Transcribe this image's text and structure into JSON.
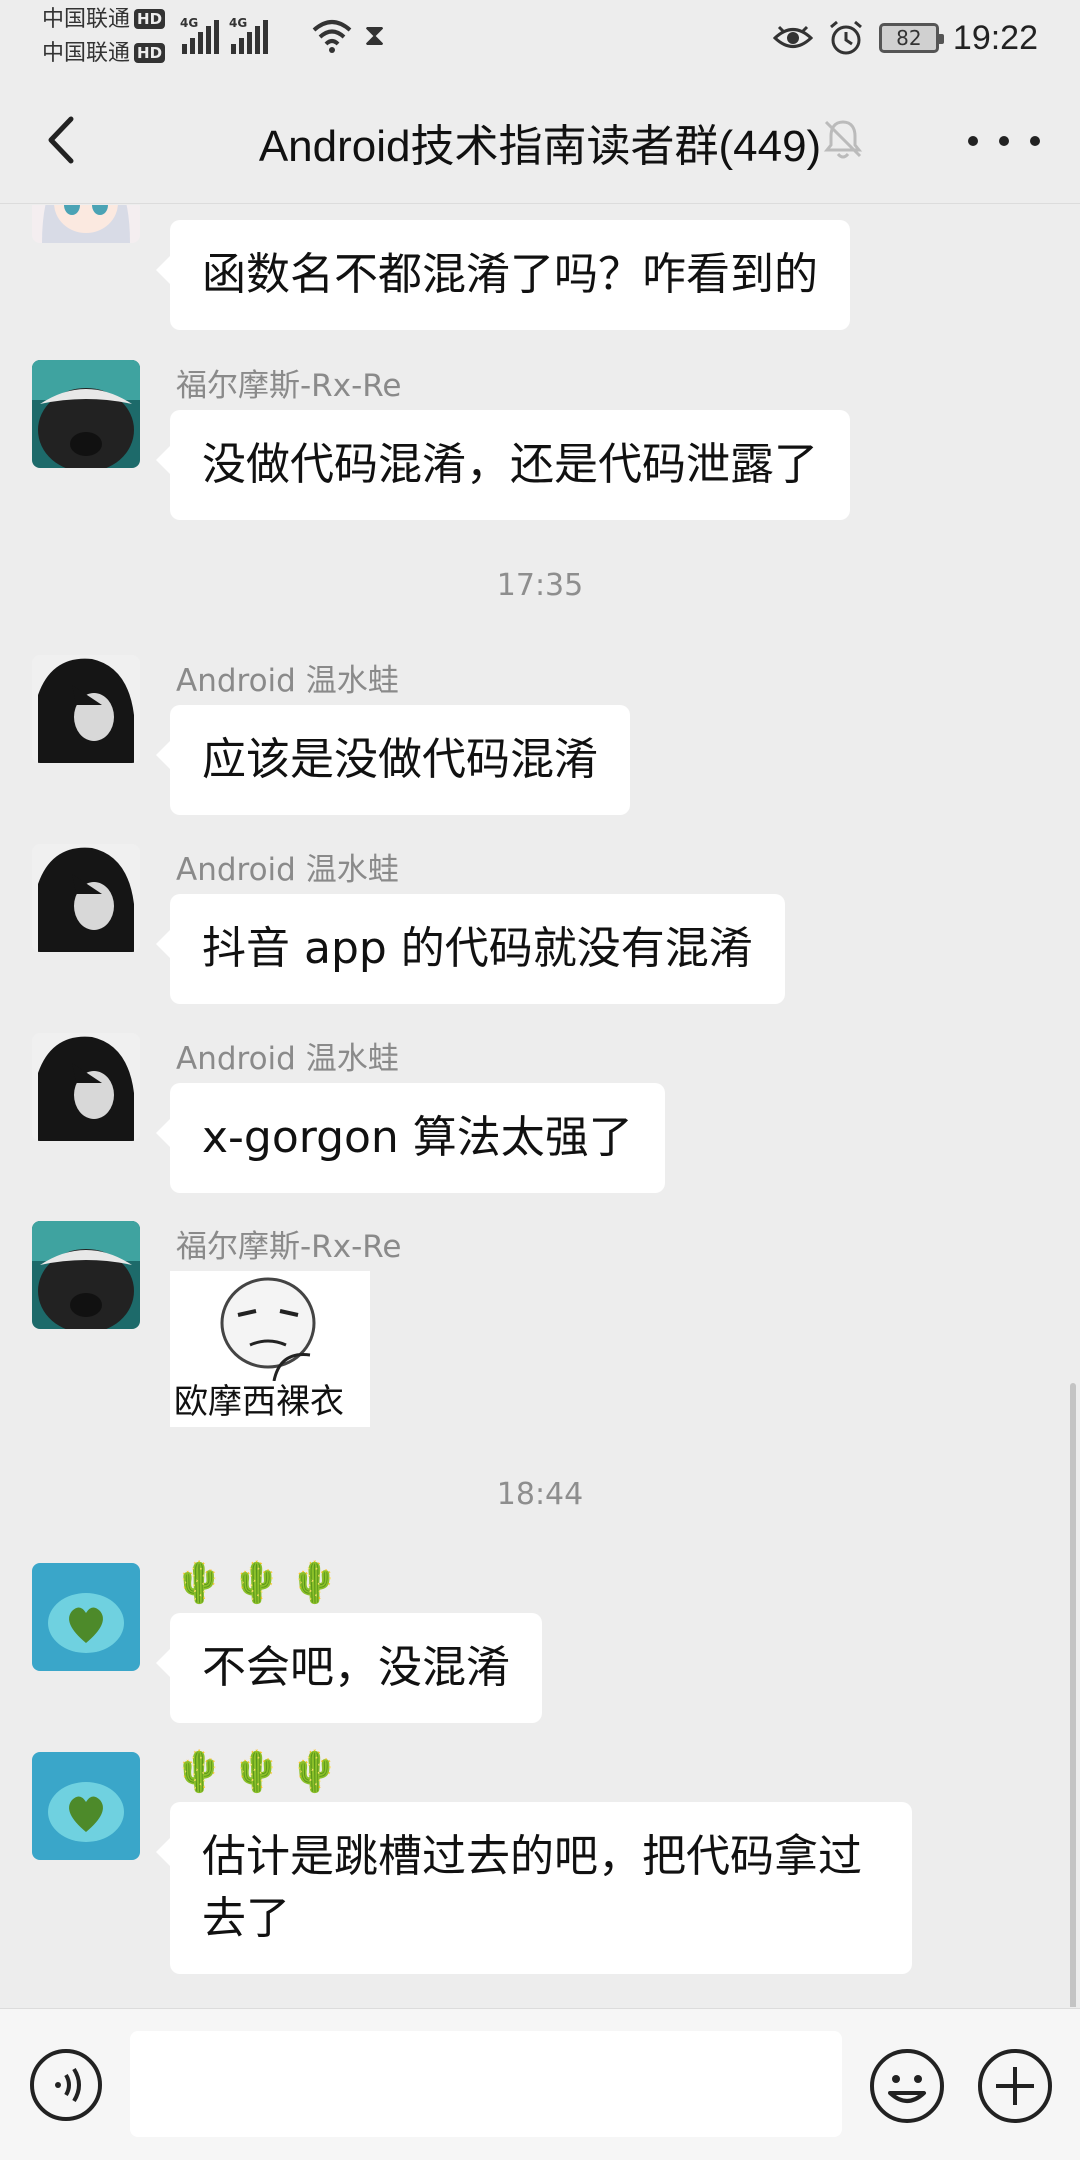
{
  "status_bar": {
    "carrier1": "中国联通",
    "carrier2": "中国联通",
    "hd": "HD",
    "network1": "4G",
    "network2": "4G",
    "battery": "82",
    "time": "19:22"
  },
  "nav": {
    "title": "Android技术指南读者群(449)"
  },
  "messages": [
    {
      "sender": "",
      "text": "函数名不都混淆了吗？咋看到的"
    },
    {
      "sender": "福尔摩斯-Rx-Re",
      "text": "没做代码混淆，还是代码泄露了"
    },
    {
      "sender": "Android 温水蛙",
      "text": "应该是没做代码混淆"
    },
    {
      "sender": "Android 温水蛙",
      "text": "抖音 app 的代码就没有混淆"
    },
    {
      "sender": "Android 温水蛙",
      "text": "x-gorgon 算法太强了"
    },
    {
      "sender": "福尔摩斯-Rx-Re",
      "sticker_text": "欧摩西裸衣"
    },
    {
      "sender": "🌵🌵🌵",
      "text": "不会吧，没混淆"
    },
    {
      "sender": "🌵🌵🌵",
      "text": "估计是跳槽过去的吧，把代码拿过去了"
    }
  ],
  "timestamps": [
    "17:35",
    "18:44"
  ],
  "input": {
    "value": "",
    "placeholder": ""
  },
  "colors": {
    "background": "#ededed",
    "bubble": "#ffffff",
    "sender": "#8a8a8a"
  }
}
